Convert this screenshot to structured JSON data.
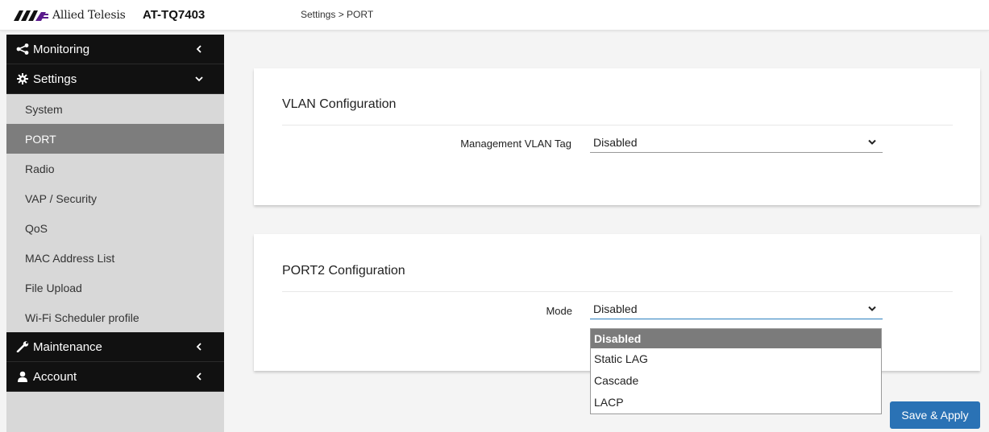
{
  "header": {
    "brand": "Allied Telesis",
    "model": "AT-TQ7403",
    "breadcrumb": "Settings > PORT"
  },
  "sidebar": {
    "groups": [
      {
        "label": "Monitoring",
        "icon": "share-icon",
        "expanded": false
      },
      {
        "label": "Settings",
        "icon": "gear-icon",
        "expanded": true
      },
      {
        "label": "Maintenance",
        "icon": "wrench-icon",
        "expanded": false
      },
      {
        "label": "Account",
        "icon": "user-icon",
        "expanded": false
      }
    ],
    "settings_items": [
      {
        "label": "System"
      },
      {
        "label": "PORT",
        "active": true
      },
      {
        "label": "Radio"
      },
      {
        "label": "VAP / Security"
      },
      {
        "label": "QoS"
      },
      {
        "label": "MAC Address List"
      },
      {
        "label": "File Upload"
      },
      {
        "label": "Wi-Fi Scheduler profile"
      }
    ]
  },
  "vlan": {
    "title": "VLAN Configuration",
    "field_label": "Management VLAN Tag",
    "value": "Disabled"
  },
  "port2": {
    "title": "PORT2 Configuration",
    "field_label": "Mode",
    "value": "Disabled",
    "options": [
      "Disabled",
      "Static LAG",
      "Cascade",
      "LACP"
    ]
  },
  "actions": {
    "save_label": "Save & Apply"
  },
  "colors": {
    "sidebar_dark": "#111111",
    "sidebar_bg": "#d8d8d8",
    "active_item": "#7d7d7d",
    "accent": "#2a72b5",
    "brand_purple": "#5a1a8c"
  }
}
